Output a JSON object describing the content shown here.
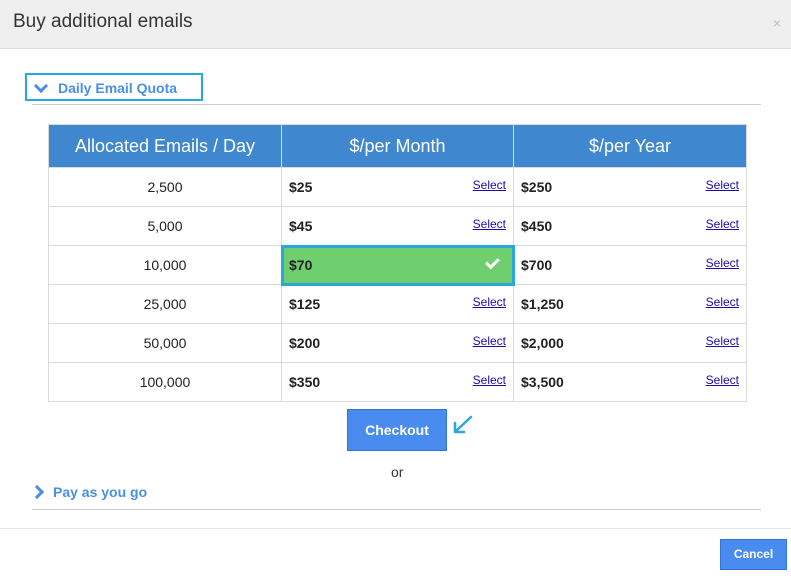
{
  "dialog": {
    "title": "Buy additional emails",
    "close_label": "×"
  },
  "daily_quota": {
    "label": "Daily Email Quota"
  },
  "table": {
    "headers": [
      "Allocated Emails / Day",
      "$/per Month",
      "$/per Year"
    ],
    "select_label": "Select",
    "rows": [
      {
        "allocated": "2,500",
        "monthly": "$25",
        "yearly": "$250"
      },
      {
        "allocated": "5,000",
        "monthly": "$45",
        "yearly": "$450"
      },
      {
        "allocated": "10,000",
        "monthly": "$70",
        "yearly": "$700"
      },
      {
        "allocated": "25,000",
        "monthly": "$125",
        "yearly": "$1,250"
      },
      {
        "allocated": "50,000",
        "monthly": "$200",
        "yearly": "$2,000"
      },
      {
        "allocated": "100,000",
        "monthly": "$350",
        "yearly": "$3,500"
      }
    ],
    "selected": {
      "row": 2,
      "column": "monthly"
    }
  },
  "checkout": {
    "label": "Checkout"
  },
  "or_text": "or",
  "pay_as_you_go": {
    "label": "Pay as you go"
  },
  "footer": {
    "cancel_label": "Cancel"
  },
  "colors": {
    "header_bg": "#3f87cf",
    "accent": "#4a90e2",
    "selected_bg": "#6fcf6f",
    "highlight_border": "#29a8df",
    "button_bg": "#4a8bef"
  }
}
